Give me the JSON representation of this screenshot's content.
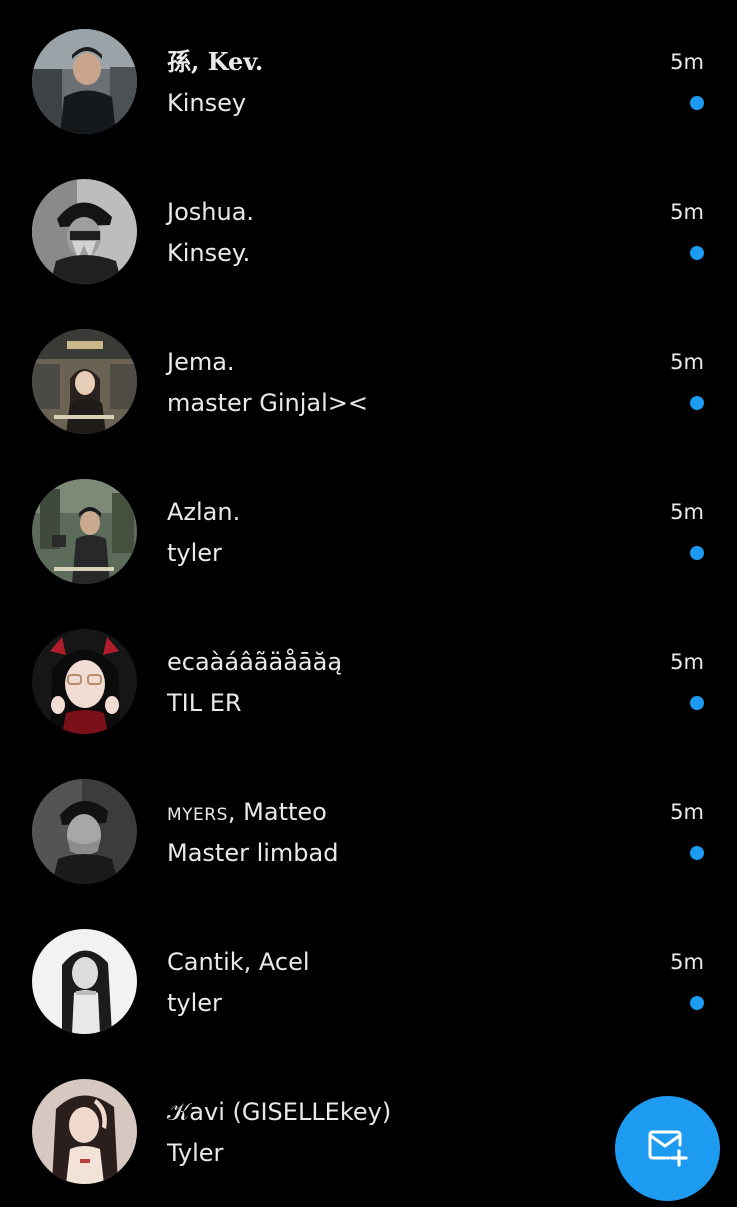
{
  "colors": {
    "background": "#000000",
    "text": "#e7e9ea",
    "accent": "#1d9bf0",
    "unread_dot": "#1d9bf0"
  },
  "conversations": [
    {
      "name_prefix": "孫, ",
      "name": "Kev.",
      "preview": "Kinsey",
      "time": "5m",
      "unread": true
    },
    {
      "name_prefix": "",
      "name": "Joshua.",
      "preview": "Kinsey.",
      "time": "5m",
      "unread": true
    },
    {
      "name_prefix": "",
      "name": "Jema.",
      "preview": "master Ginjal><",
      "time": "5m",
      "unread": true
    },
    {
      "name_prefix": "",
      "name": "Azlan.",
      "preview": "tyler",
      "time": "5m",
      "unread": true
    },
    {
      "name_prefix": "",
      "name": "ecaàáâãäåāăą",
      "preview": "TIL ER",
      "time": "5m",
      "unread": true
    },
    {
      "name_prefix": "MYERS",
      "name": ", Matteo",
      "preview": "Master limbad",
      "time": "5m",
      "unread": true
    },
    {
      "name_prefix": "",
      "name": "Cantik, Acel",
      "preview": "tyler",
      "time": "5m",
      "unread": true
    },
    {
      "name_prefix": "𝒦avi",
      "name": " (GISELLEkey)",
      "preview": "Tyler",
      "time": "",
      "unread": false
    }
  ],
  "fab": {
    "icon": "new-message-icon"
  }
}
